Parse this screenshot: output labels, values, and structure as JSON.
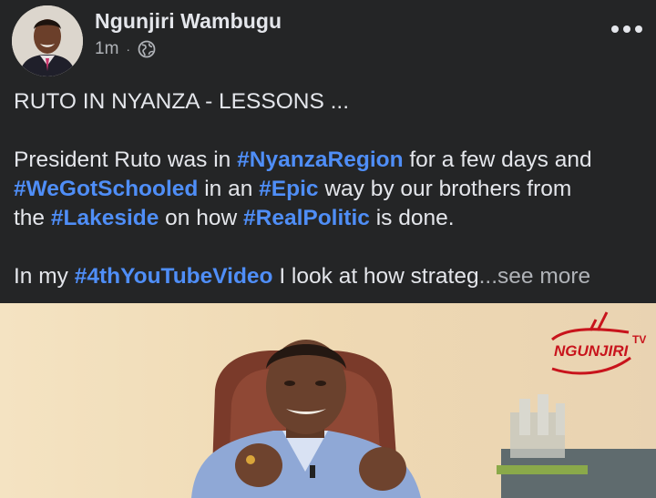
{
  "post": {
    "author": "Ngunjiri Wambugu",
    "time": "1m",
    "separator": "·",
    "privacy_icon": "globe-icon",
    "more_icon": "more-options-icon",
    "title": "RUTO IN NYANZA - LESSONS ...",
    "p2": {
      "s1": "President Ruto was in ",
      "h1": "#NyanzaRegion",
      "s2": " for a few days and",
      "h2": "#WeGotSchooled",
      "s3": " in an ",
      "h3": "#Epic",
      "s4": " way by our brothers from",
      "s5": "the ",
      "h4": "#Lakeside",
      "s6": " on how ",
      "h5": "#RealPolitic",
      "s7": " is done."
    },
    "p3": {
      "s1": "In my ",
      "h1": "#4thYouTubeVideo",
      "s2": " I look at how strateg",
      "see_more": "...see more"
    }
  },
  "media": {
    "watermark": "NGUNJIRI",
    "watermark_sup": "TV"
  },
  "colors": {
    "background": "#242526",
    "text": "#e4e6eb",
    "hashtag": "#4f8ef7",
    "muted": "#b0b3b8",
    "watermark_red": "#c8141c"
  }
}
